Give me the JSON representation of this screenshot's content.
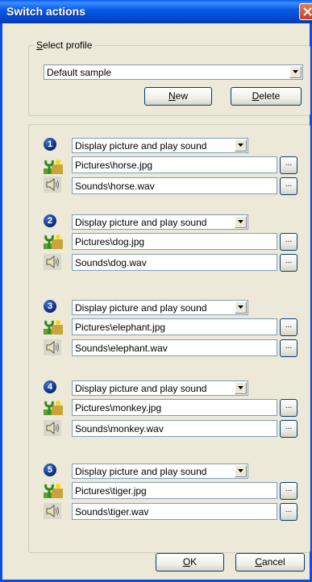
{
  "window": {
    "title": "Switch actions"
  },
  "profile": {
    "group_label_accesskey": "S",
    "group_label_rest": "elect profile",
    "selected": "Default sample",
    "new_button": {
      "accesskey": "N",
      "rest": "ew"
    },
    "delete_button": {
      "accesskey": "D",
      "rest": "elete"
    }
  },
  "actions": [
    {
      "number": "1",
      "mode": "Display picture and play sound",
      "picture": "Pictures\\horse.jpg",
      "sound": "Sounds\\horse.wav"
    },
    {
      "number": "2",
      "mode": "Display picture and play sound",
      "picture": "Pictures\\dog.jpg",
      "sound": "Sounds\\dog.wav"
    },
    {
      "number": "3",
      "mode": "Display picture and play sound",
      "picture": "Pictures\\elephant.jpg",
      "sound": "Sounds\\elephant.wav"
    },
    {
      "number": "4",
      "mode": "Display picture and play sound",
      "picture": "Pictures\\monkey.jpg",
      "sound": "Sounds\\monkey.wav"
    },
    {
      "number": "5",
      "mode": "Display picture and play sound",
      "picture": "Pictures\\tiger.jpg",
      "sound": "Sounds\\tiger.wav"
    }
  ],
  "browse_label": "...",
  "footer": {
    "ok_button": {
      "accesskey": "O",
      "rest": "K"
    },
    "cancel_button": {
      "accesskey": "C",
      "rest": "ancel"
    }
  },
  "icons": {
    "action_number": "numbered-circle-icon",
    "picture": "picture-icon",
    "sound": "speaker-icon",
    "dropdown": "chevron-down-icon",
    "close": "close-icon"
  },
  "colors": {
    "titlebar": "#0a4ee0",
    "dialog_bg": "#ece9d8",
    "field_border": "#7f9db9",
    "button_border": "#003c74"
  }
}
